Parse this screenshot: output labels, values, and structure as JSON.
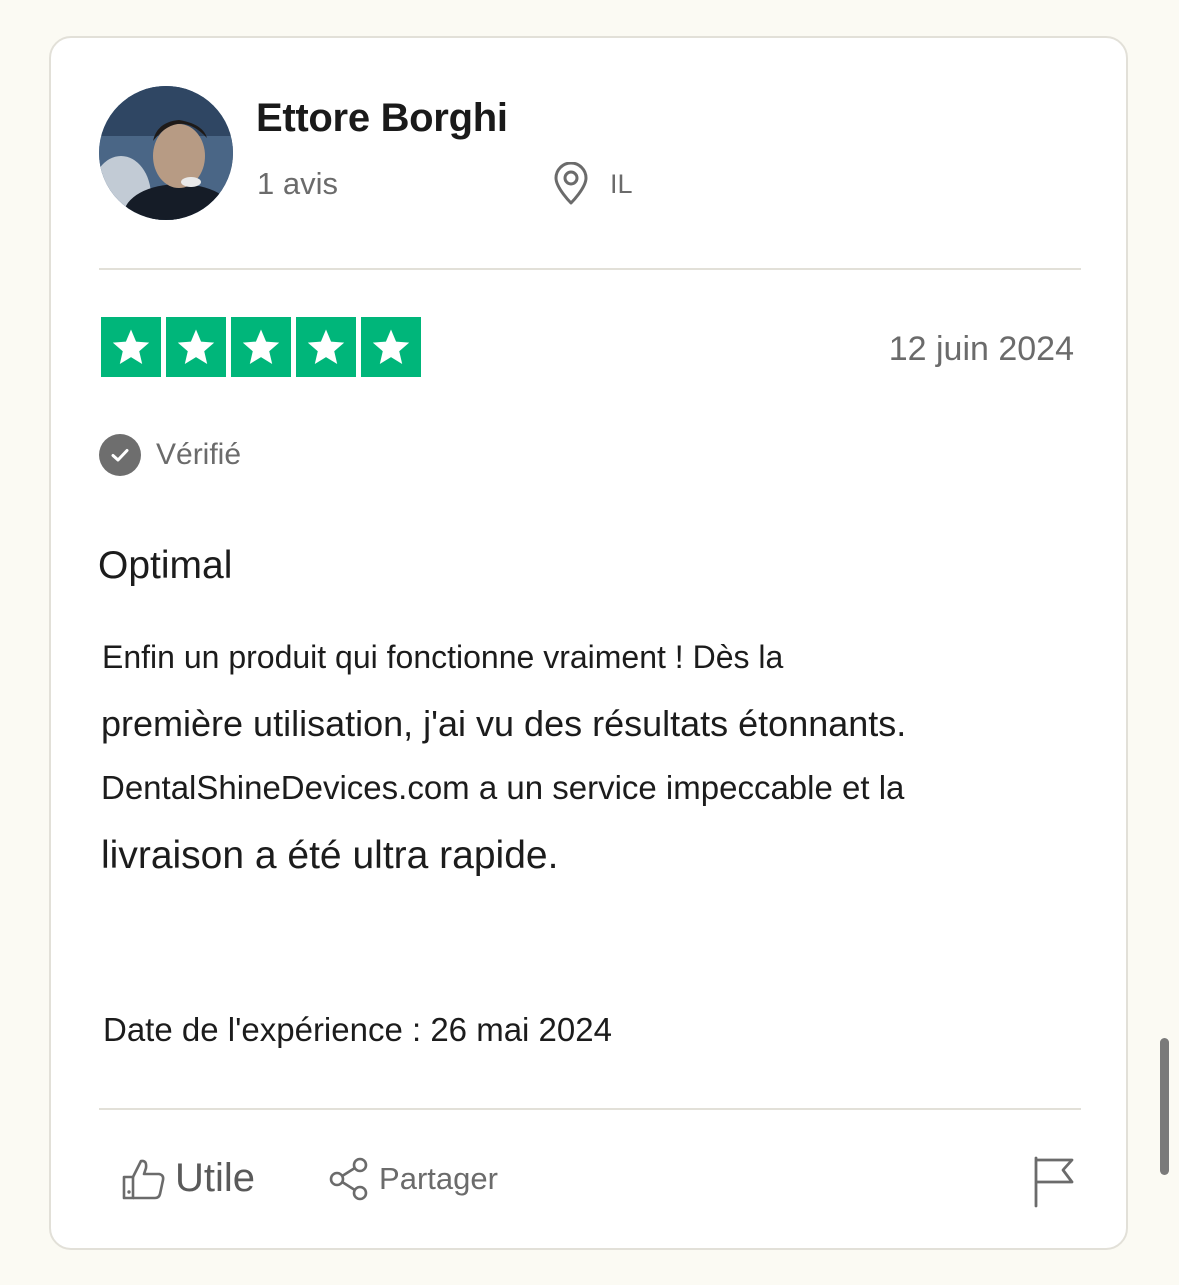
{
  "reviewer": {
    "name": "Ettore Borghi",
    "review_count": "1 avis",
    "country": "IL"
  },
  "review": {
    "rating_stars": 5,
    "date": "12 juin 2024",
    "verified_label": "Vérifié",
    "title": "Optimal",
    "body_lines": [
      "Enfin un produit qui fonctionne vraiment ! Dès la",
      "première utilisation, j'ai vu des résultats étonnants.",
      "DentalShineDevices.com a un service impeccable et la",
      "livraison a été ultra rapide."
    ],
    "experience_date": "Date de l'expérience : 26 mai 2024"
  },
  "actions": {
    "useful_label": "Utile",
    "share_label": "Partager"
  },
  "icons": {
    "pin": "location-pin-icon",
    "star": "star-icon",
    "check": "check-icon",
    "thumbs_up": "thumbs-up-icon",
    "share": "share-icon",
    "flag": "flag-icon"
  },
  "colors": {
    "star_green": "#00b67a",
    "verified_gray": "#6e6e6e",
    "page_background": "#fbfaf3"
  }
}
